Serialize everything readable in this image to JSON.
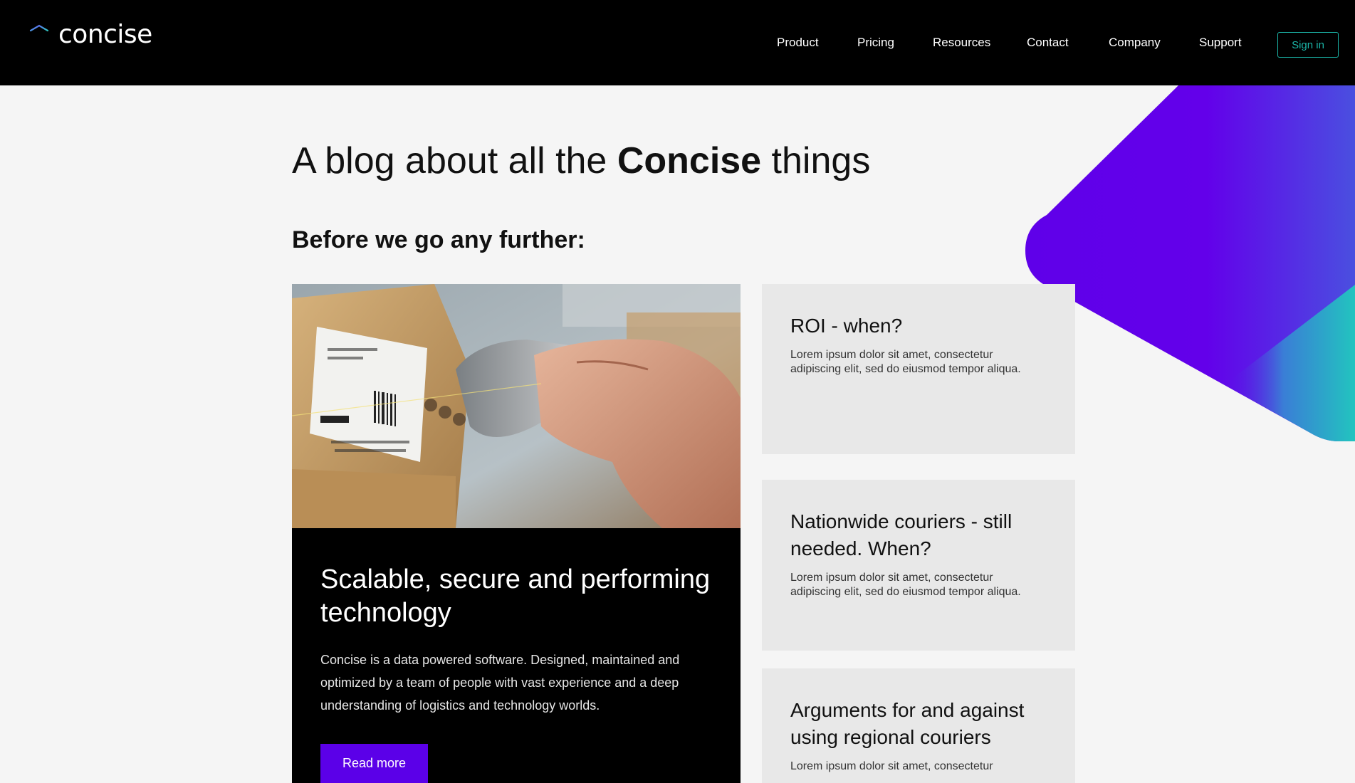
{
  "brand": {
    "name": "concise",
    "logo_icon": "concise-logo-icon"
  },
  "nav": {
    "items": [
      "Product",
      "Pricing",
      "Resources",
      "Contact",
      "Company",
      "Support"
    ],
    "signin_label": "Sign in"
  },
  "colors": {
    "accent": "#5b00e8",
    "teal": "#1bb3a6",
    "header_bg": "#000000",
    "page_bg": "#f5f5f5",
    "card_bg": "#e8e8e8"
  },
  "hero": {
    "title_before": "A blog about all the ",
    "title_bold": "Concise",
    "title_after": " things"
  },
  "section": {
    "title": "Before we go any further:"
  },
  "featured": {
    "image": "barcode-scanner-photo",
    "title": "Scalable, secure and performing technology",
    "text": "Concise is a data powered software. Designed, maintained and optimized by a team of people with vast experience and a deep understanding of logistics and technology worlds.",
    "button_label": "Read more"
  },
  "cards": [
    {
      "title": "ROI - when?",
      "text": "Lorem ipsum dolor sit amet, consectetur adipiscing elit, sed do eiusmod tempor aliqua."
    },
    {
      "title": "Nationwide couriers - still needed. When?",
      "text": "Lorem ipsum dolor sit amet, consectetur adipiscing elit, sed do eiusmod tempor aliqua."
    },
    {
      "title": "Arguments for and against using regional couriers",
      "text": "Lorem ipsum dolor sit amet, consectetur"
    }
  ]
}
